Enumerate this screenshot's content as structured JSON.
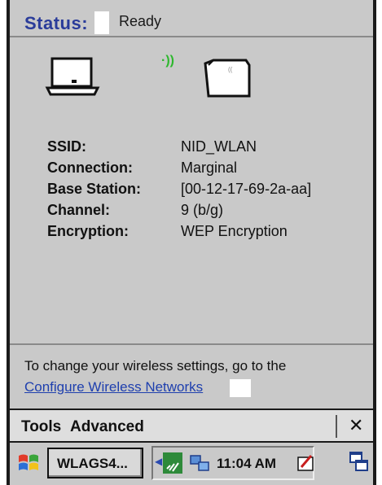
{
  "status": {
    "label": "Status:",
    "value": "Ready"
  },
  "details": [
    {
      "key": "SSID:",
      "value": "NID_WLAN"
    },
    {
      "key": "Connection:",
      "value": "Marginal"
    },
    {
      "key": "Base Station:",
      "value": "[00-12-17-69-2a-aa]"
    },
    {
      "key": "Channel:",
      "value": "9  (b/g)"
    },
    {
      "key": "Encryption:",
      "value": "WEP Encryption"
    }
  ],
  "hint": {
    "text": "To change your wireless settings, go to the",
    "link": "Configure Wireless Networks"
  },
  "menu": {
    "tools": "Tools",
    "advanced": "Advanced",
    "close": "✕"
  },
  "taskbar": {
    "task": "WLAGS4...",
    "time": "11:04 AM"
  },
  "icons": {
    "signal": "·))",
    "laptop": "laptop-icon",
    "basestation": "access-point-icon"
  },
  "colors": {
    "status_label": "#2a3c9a",
    "link": "#1e3fae",
    "signal": "#2db82d",
    "panel": "#c9c9c9"
  }
}
